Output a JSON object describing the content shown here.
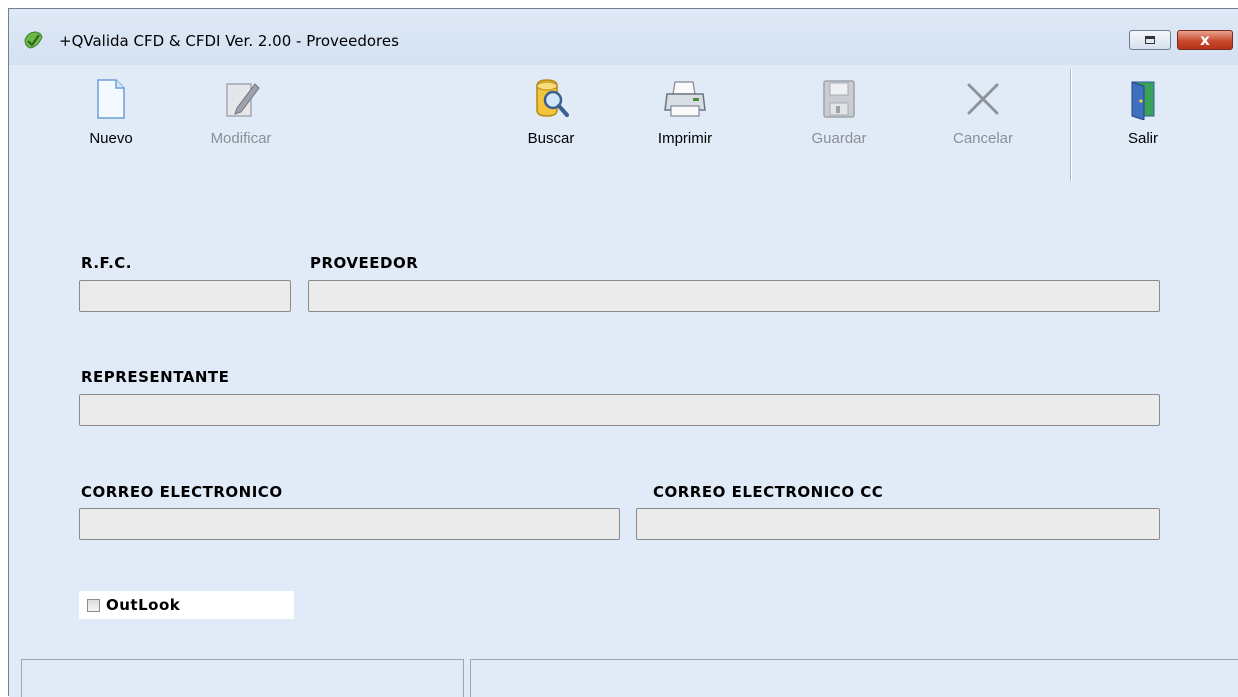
{
  "window": {
    "title": "+QValida CFD & CFDI Ver. 2.00 - Proveedores",
    "close_label": "x"
  },
  "toolbar": {
    "nuevo": "Nuevo",
    "modificar": "Modificar",
    "buscar": "Buscar",
    "imprimir": "Imprimir",
    "guardar": "Guardar",
    "cancelar": "Cancelar",
    "salir": "Salir"
  },
  "form": {
    "rfc_label": "R.F.C.",
    "rfc_value": "",
    "proveedor_label": "PROVEEDOR",
    "proveedor_value": "",
    "representante_label": "REPRESENTANTE",
    "representante_value": "",
    "correo_label": "CORREO ELECTRONICO",
    "correo_value": "",
    "correo_cc_label": "CORREO ELECTRONICO CC",
    "correo_cc_value": "",
    "outlook_label": "OutLook",
    "outlook_checked": false
  },
  "statusbar": {
    "left": "",
    "right": ""
  },
  "colors": {
    "background": "#e1ebf8",
    "field": "#ebebeb",
    "disabled_text": "#8a8f97"
  }
}
